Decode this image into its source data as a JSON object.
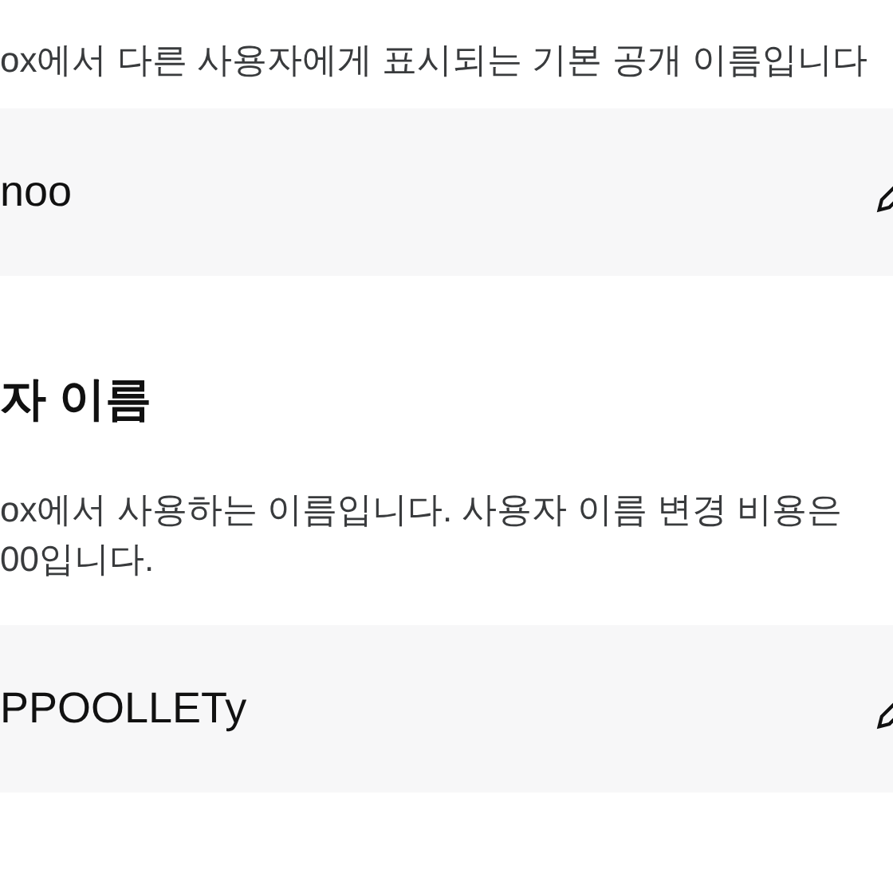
{
  "display_name": {
    "description": "ox에서 다른 사용자에게 표시되는 기본 공개 이름입니다",
    "value": "noo"
  },
  "username": {
    "heading": "자 이름",
    "description": [
      "ox에서 사용하는 이름입니다. 사용자 이름 변경 비용은",
      "00입니다."
    ],
    "value": "PPOOLLETy"
  }
}
